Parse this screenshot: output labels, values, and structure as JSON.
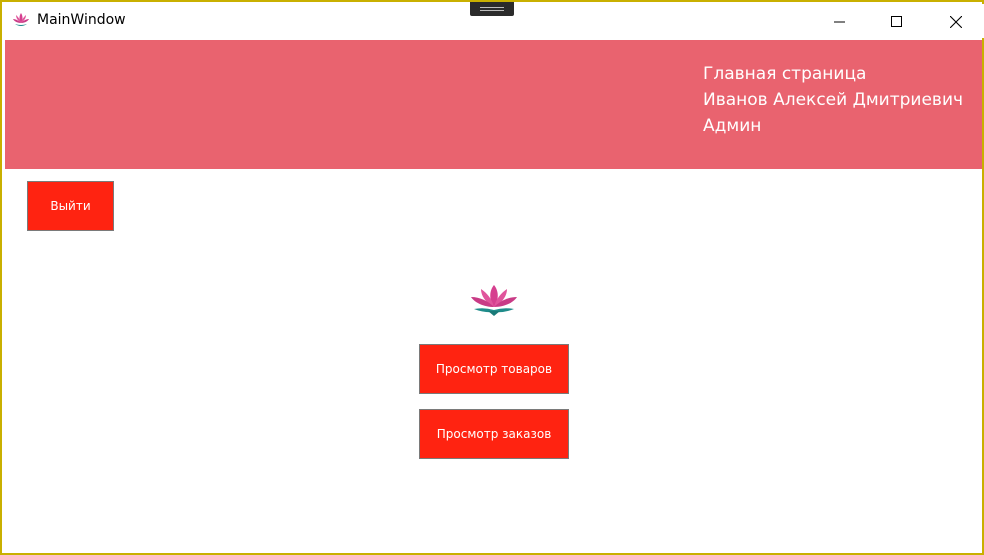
{
  "window": {
    "title": "MainWindow",
    "icon": "lotus-icon",
    "controls": [
      "minimize-icon",
      "maximize-icon",
      "close-icon"
    ]
  },
  "header": {
    "page_title": "Главная страница",
    "user_name": "Иванов Алексей Дмитриевич",
    "role": "Админ",
    "background_color": "#e9636f"
  },
  "actions": {
    "exit_label": "Выйти",
    "view_products_label": "Просмотр товаров",
    "view_orders_label": "Просмотр заказов",
    "button_color": "#ff2311"
  },
  "logo": {
    "icon": "lotus-icon"
  }
}
